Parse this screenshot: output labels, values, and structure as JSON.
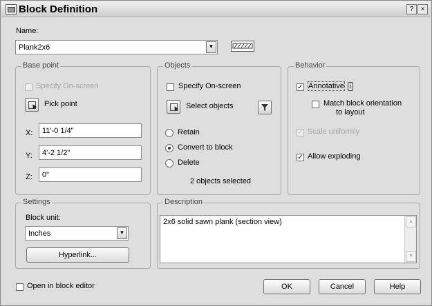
{
  "window": {
    "title": "Block Definition",
    "help_glyph": "?",
    "close_glyph": "×"
  },
  "name": {
    "label": "Name:",
    "value": "Plank2x6"
  },
  "base_point": {
    "legend": "Base point",
    "specify_on_screen": "Specify On-screen",
    "pick_point": "Pick point",
    "x_label": "X:",
    "x_value": "11'-0 1/4\"",
    "y_label": "Y:",
    "y_value": "4'-2 1/2\"",
    "z_label": "Z:",
    "z_value": "0\""
  },
  "objects": {
    "legend": "Objects",
    "specify_on_screen": "Specify On-screen",
    "select_objects": "Select objects",
    "retain": "Retain",
    "convert": "Convert to block",
    "delete": "Delete",
    "selected_count": "2 objects selected"
  },
  "behavior": {
    "legend": "Behavior",
    "annotative": "Annotative",
    "annotative_badge": "i",
    "match_orientation_1": "Match block orientation",
    "match_orientation_2": "to layout",
    "scale_uniformly": "Scale uniformly",
    "allow_exploding": "Allow exploding"
  },
  "settings": {
    "legend": "Settings",
    "block_unit_label": "Block unit:",
    "block_unit_value": "Inches",
    "hyperlink": "Hyperlink..."
  },
  "description": {
    "legend": "Description",
    "text": "2x6 solid sawn plank (section view)"
  },
  "footer": {
    "open_in_editor": "Open in block editor",
    "ok": "OK",
    "cancel": "Cancel",
    "help": "Help"
  }
}
